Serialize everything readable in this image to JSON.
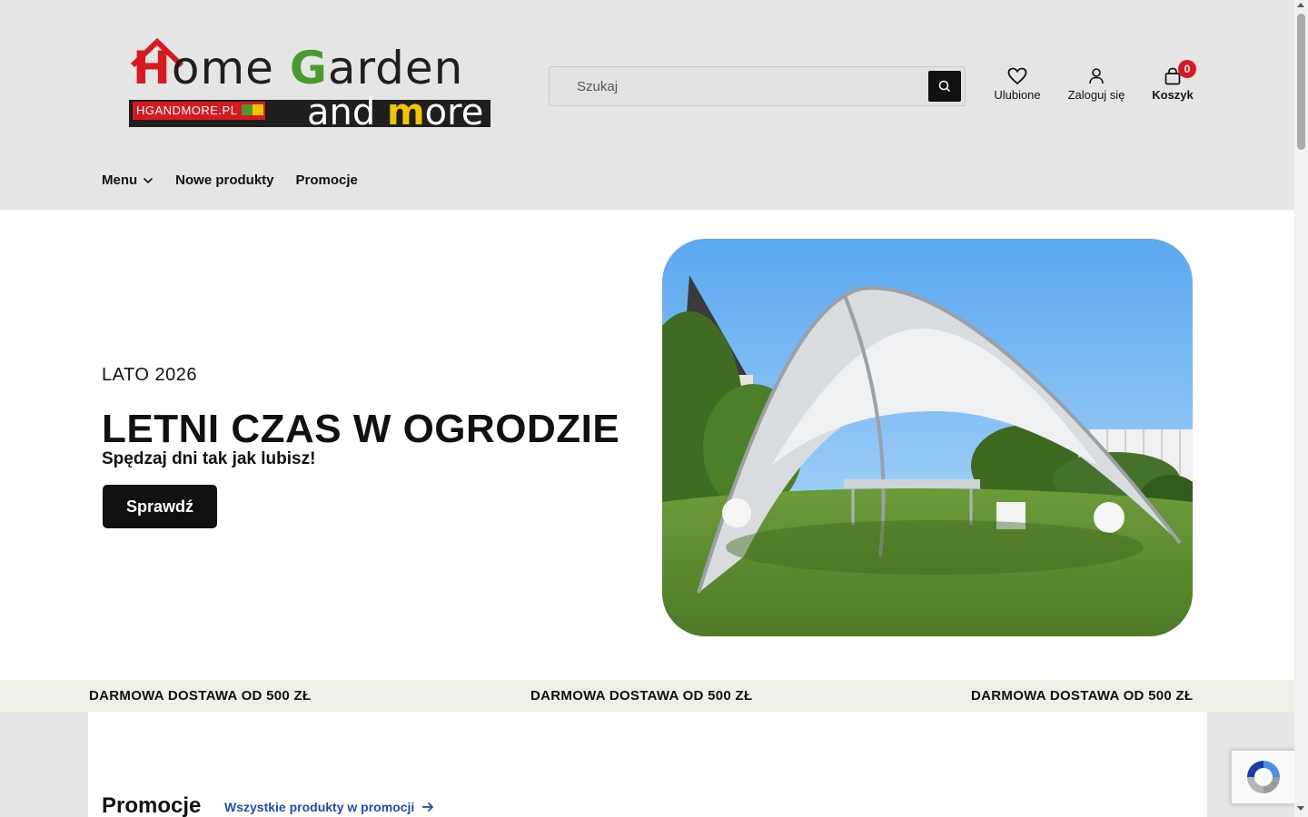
{
  "logo": {
    "line1_h": "H",
    "line1_rest_a": "ome ",
    "line1_g": "G",
    "line1_rest_b": "arden",
    "tagline": "HGANDMORE.PL",
    "line2_a": "and ",
    "line2_m": "m",
    "line2_b": "ore"
  },
  "search": {
    "placeholder": "Szukaj"
  },
  "header_actions": {
    "favorites": "Ulubione",
    "login": "Zaloguj się",
    "cart": "Koszyk",
    "cart_count": "0"
  },
  "nav": {
    "menu": "Menu",
    "new_products": "Nowe produkty",
    "promotions": "Promocje"
  },
  "hero": {
    "subtitle": "LATO 2026",
    "title": "LETNI CZAS W OGRODZIE",
    "text": "Spędzaj dni tak jak lubisz!",
    "button": "Sprawdź"
  },
  "strip": {
    "items": [
      "DARMOWA DOSTAWA OD 500 ZŁ",
      "DARMOWA DOSTAWA OD 500 ZŁ",
      "DARMOWA DOSTAWA OD 500 ZŁ"
    ]
  },
  "promotions": {
    "title": "Promocje",
    "link": "Wszystkie produkty w promocji"
  },
  "colors": {
    "header_bg": "#e5e5e5",
    "accent_red": "#d7191f",
    "link_blue": "#1a4fb5",
    "button_dark": "#111111",
    "strip_bg": "#efefe9"
  }
}
